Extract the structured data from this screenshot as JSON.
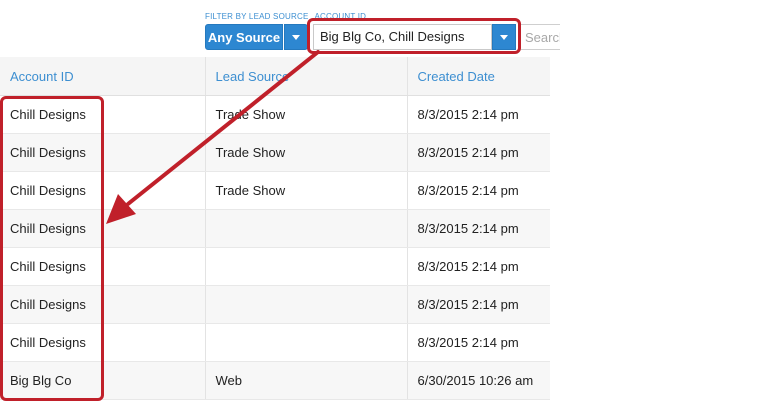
{
  "filters": {
    "lead_source_label": "FILTER BY LEAD SOURCE",
    "account_id_label": "ACCOUNT ID",
    "lead_source_value": "Any Source",
    "account_id_value": "Big Blg Co, Chill Designs",
    "search_placeholder": "Search"
  },
  "table": {
    "headers": [
      "Account ID",
      "Lead Source",
      "Created Date"
    ],
    "rows": [
      {
        "account": "Chill Designs",
        "source": "Trade Show",
        "created": "8/3/2015 2:14 pm"
      },
      {
        "account": "Chill Designs",
        "source": "Trade Show",
        "created": "8/3/2015 2:14 pm"
      },
      {
        "account": "Chill Designs",
        "source": "Trade Show",
        "created": "8/3/2015 2:14 pm"
      },
      {
        "account": "Chill Designs",
        "source": "",
        "created": "8/3/2015 2:14 pm"
      },
      {
        "account": "Chill Designs",
        "source": "",
        "created": "8/3/2015 2:14 pm"
      },
      {
        "account": "Chill Designs",
        "source": "",
        "created": "8/3/2015 2:14 pm"
      },
      {
        "account": "Chill Designs",
        "source": "",
        "created": "8/3/2015 2:14 pm"
      },
      {
        "account": "Big Blg Co",
        "source": "Web",
        "created": "6/30/2015 10:26 am"
      }
    ]
  },
  "colors": {
    "accent": "#2d87d1",
    "header_text": "#3d8fd1",
    "callout": "#c0202a"
  }
}
